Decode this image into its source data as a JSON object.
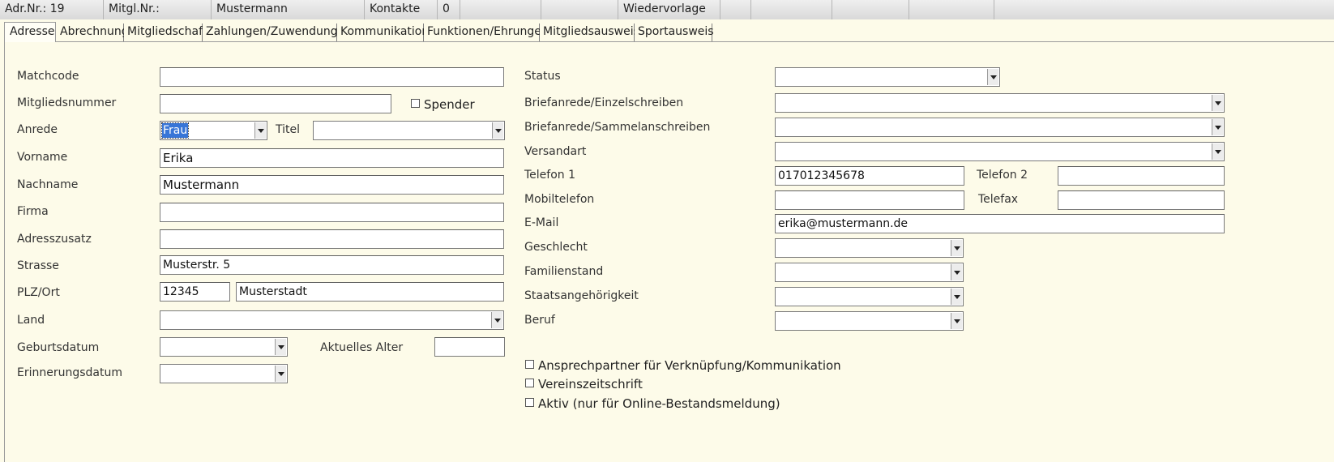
{
  "topbar": {
    "adr_nr": "Adr.Nr.: 19",
    "mitgl_nr": "Mitgl.Nr.:",
    "name": "Mustermann",
    "kontakte_label": "Kontakte",
    "kontakte_count": "0",
    "wiedervorlage": "Wiedervorlage"
  },
  "tabs": [
    {
      "label": "Adresse",
      "active": true
    },
    {
      "label": "Abrechnung"
    },
    {
      "label": "Mitgliedschaft"
    },
    {
      "label": "Zahlungen/Zuwendungen"
    },
    {
      "label": "Kommunikation"
    },
    {
      "label": "Funktionen/Ehrungen"
    },
    {
      "label": "Mitgliedsausweis"
    },
    {
      "label": "Sportausweis"
    }
  ],
  "left": {
    "matchcode": {
      "label": "Matchcode",
      "value": ""
    },
    "mitgliedsnummer": {
      "label": "Mitgliedsnummer",
      "value": ""
    },
    "spender": {
      "label": "Spender",
      "checked": false
    },
    "anrede": {
      "label": "Anrede",
      "value": "Frau"
    },
    "titel": {
      "label": "Titel",
      "value": ""
    },
    "vorname": {
      "label": "Vorname",
      "value": "Erika"
    },
    "nachname": {
      "label": "Nachname",
      "value": "Mustermann"
    },
    "firma": {
      "label": "Firma",
      "value": ""
    },
    "adresszusatz": {
      "label": "Adresszusatz",
      "value": ""
    },
    "strasse": {
      "label": "Strasse",
      "value": "Musterstr. 5"
    },
    "plz_ort": {
      "label": "PLZ/Ort",
      "plz": "12345",
      "ort": "Musterstadt"
    },
    "land": {
      "label": "Land",
      "value": ""
    },
    "geburtsdatum": {
      "label": "Geburtsdatum",
      "value": ""
    },
    "aktuelles_alter": {
      "label": "Aktuelles Alter",
      "value": ""
    },
    "erinnerungsdatum": {
      "label": "Erinnerungsdatum",
      "value": ""
    }
  },
  "right": {
    "status": {
      "label": "Status",
      "value": ""
    },
    "briefanrede_einzel": {
      "label": "Briefanrede/Einzelschreiben",
      "value": ""
    },
    "briefanrede_sammel": {
      "label": "Briefanrede/Sammelanschreiben",
      "value": ""
    },
    "versandart": {
      "label": "Versandart",
      "value": ""
    },
    "telefon1": {
      "label": "Telefon 1",
      "value": "017012345678"
    },
    "telefon2": {
      "label": "Telefon 2",
      "value": ""
    },
    "mobiltelefon": {
      "label": "Mobiltelefon",
      "value": ""
    },
    "telefax": {
      "label": "Telefax",
      "value": ""
    },
    "email": {
      "label": "E-Mail",
      "value": "erika@mustermann.de"
    },
    "geschlecht": {
      "label": "Geschlecht",
      "value": ""
    },
    "familienstand": {
      "label": "Familienstand",
      "value": ""
    },
    "staatsangehoerigkeit": {
      "label": "Staatsangehörigkeit",
      "value": ""
    },
    "beruf": {
      "label": "Beruf",
      "value": ""
    }
  },
  "checkboxes": [
    {
      "label": "Ansprechpartner für Verknüpfung/Kommunikation",
      "checked": false
    },
    {
      "label": "Vereinszeitschrift",
      "checked": false
    },
    {
      "label": "Aktiv (nur für Online-Bestandsmeldung)",
      "checked": false
    }
  ],
  "icons": {
    "dropdown": "chevron-down-icon",
    "checkbox": "checkbox-icon"
  },
  "colors": {
    "background": "#fdfbe9",
    "selection": "#3875d7",
    "topbar": "#e3e3e3"
  }
}
